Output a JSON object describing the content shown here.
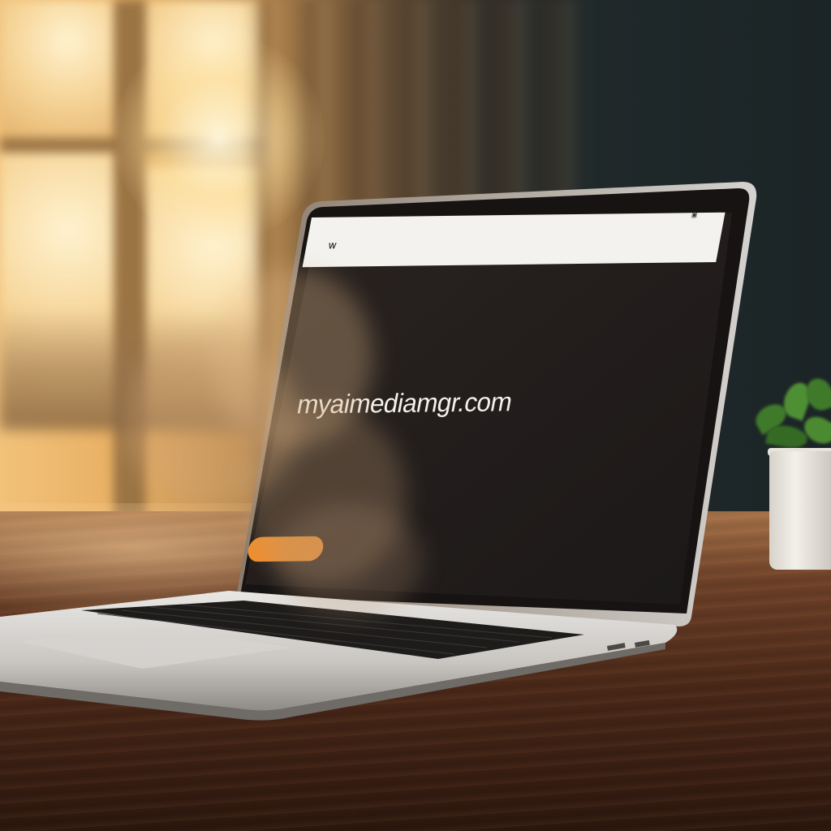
{
  "scene": {
    "description_colors": {
      "accent": "#ee8e2e",
      "screen_bg": "#221e1e",
      "nav_bg": "#f3f2ef"
    }
  },
  "website": {
    "nav": {
      "logo": "W",
      "brand": "",
      "links": [
        "",
        "",
        "",
        "",
        "",
        ""
      ],
      "action_icon": "bookmark-icon"
    },
    "hero": {
      "title": "myaimediamgr.com",
      "body_lines": [
        "",
        "",
        "",
        "",
        ""
      ],
      "cta_label": ""
    }
  }
}
